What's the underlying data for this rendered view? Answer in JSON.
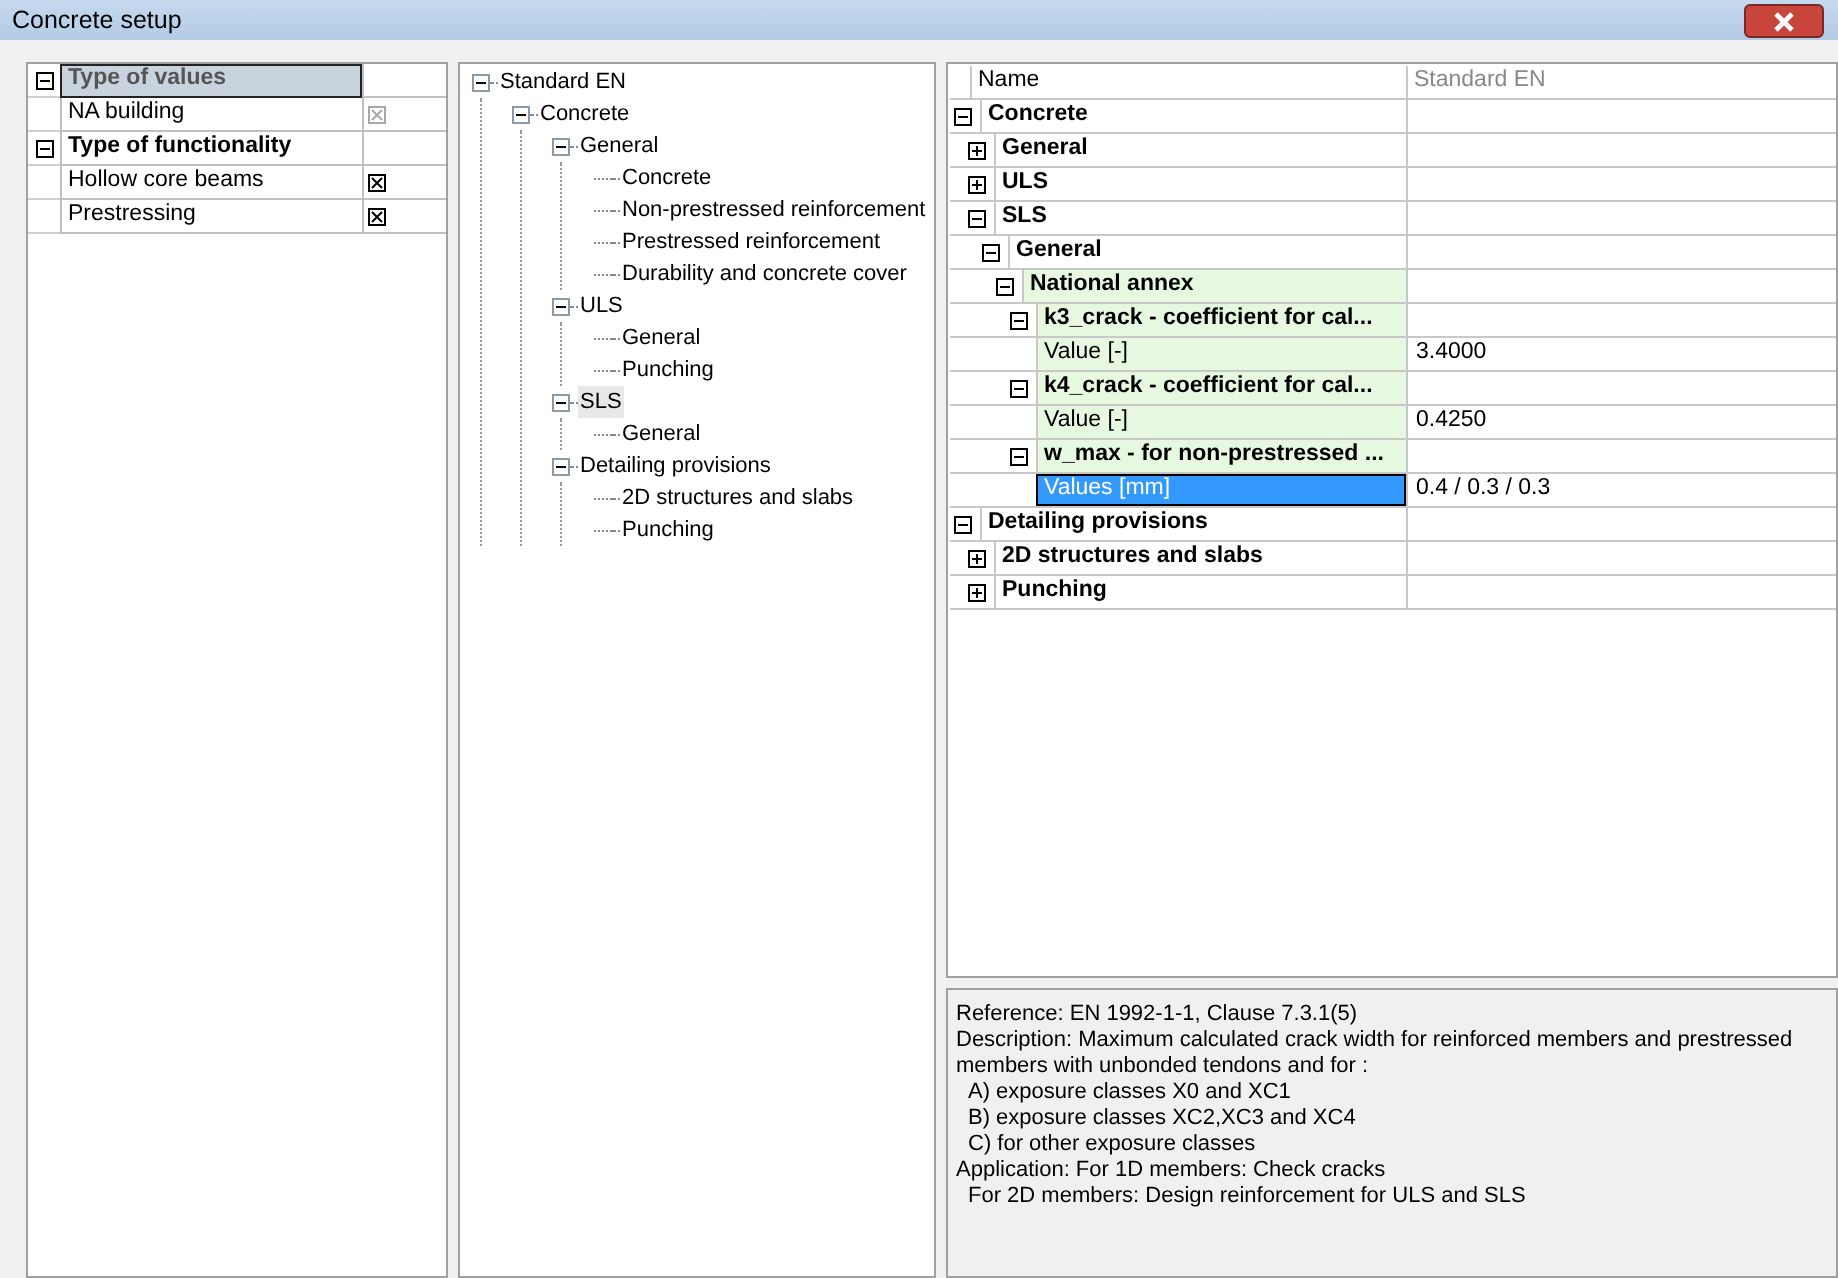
{
  "window": {
    "title": "Concrete setup"
  },
  "settings": [
    {
      "kind": "header",
      "label": "Type of values",
      "expanded": true,
      "selected": true
    },
    {
      "kind": "item",
      "label": "NA building",
      "checked": true,
      "disabled": true
    },
    {
      "kind": "header",
      "label": "Type of functionality",
      "expanded": true,
      "selected": false
    },
    {
      "kind": "item",
      "label": "Hollow core beams",
      "checked": true,
      "disabled": false
    },
    {
      "kind": "item",
      "label": "Prestressing",
      "checked": true,
      "disabled": false
    }
  ],
  "tree": [
    {
      "label": "Standard EN",
      "expanded": true,
      "selected": false,
      "children": [
        {
          "label": "Concrete",
          "expanded": true,
          "selected": false,
          "children": [
            {
              "label": "General",
              "expanded": true,
              "selected": false,
              "children": [
                {
                  "label": "Concrete",
                  "selected": false
                },
                {
                  "label": "Non-prestressed reinforcement",
                  "selected": false
                },
                {
                  "label": "Prestressed reinforcement",
                  "selected": false
                },
                {
                  "label": "Durability and concrete cover",
                  "selected": false
                }
              ]
            },
            {
              "label": "ULS",
              "expanded": true,
              "selected": false,
              "children": [
                {
                  "label": "General",
                  "selected": false
                },
                {
                  "label": "Punching",
                  "selected": false
                }
              ]
            },
            {
              "label": "SLS",
              "expanded": true,
              "selected": true,
              "children": [
                {
                  "label": "General",
                  "selected": false
                }
              ]
            },
            {
              "label": "Detailing provisions",
              "expanded": true,
              "selected": false,
              "children": [
                {
                  "label": "2D structures and slabs",
                  "selected": false
                },
                {
                  "label": "Punching",
                  "selected": false
                }
              ]
            }
          ]
        }
      ]
    }
  ],
  "properties": {
    "columns": [
      "Name",
      "Standard EN"
    ],
    "rows": [
      {
        "kind": "group",
        "name": "Concrete",
        "expanded": true,
        "shaded": false,
        "children": [
          {
            "kind": "group",
            "name": "General",
            "expanded": false,
            "shaded": false
          },
          {
            "kind": "group",
            "name": "ULS",
            "expanded": false,
            "shaded": false
          },
          {
            "kind": "group",
            "name": "SLS",
            "expanded": true,
            "shaded": false,
            "children": [
              {
                "kind": "group",
                "name": "General",
                "expanded": true,
                "shaded": false,
                "children": [
                  {
                    "kind": "group",
                    "name": "National annex",
                    "expanded": true,
                    "shaded": true,
                    "children": [
                      {
                        "kind": "group",
                        "name": "k3_crack - coefficient for cal...",
                        "expanded": true,
                        "shaded": true,
                        "children": [
                          {
                            "kind": "value",
                            "name": "Value [-]",
                            "value": "3.4000",
                            "shaded": true,
                            "selected": false
                          }
                        ]
                      },
                      {
                        "kind": "group",
                        "name": "k4_crack - coefficient for cal...",
                        "expanded": true,
                        "shaded": true,
                        "children": [
                          {
                            "kind": "value",
                            "name": "Value [-]",
                            "value": "0.4250",
                            "shaded": true,
                            "selected": false
                          }
                        ]
                      },
                      {
                        "kind": "group",
                        "name": "w_max - for non-prestressed ...",
                        "expanded": true,
                        "shaded": true,
                        "children": [
                          {
                            "kind": "value",
                            "name": "Values [mm]",
                            "value": "0.4 / 0.3 / 0.3",
                            "selected": true
                          }
                        ]
                      }
                    ]
                  }
                ]
              }
            ]
          }
        ]
      },
      {
        "kind": "group",
        "name": "Detailing provisions",
        "expanded": true,
        "shaded": false,
        "children": [
          {
            "kind": "group",
            "name": "2D structures and slabs",
            "expanded": false,
            "shaded": false
          },
          {
            "kind": "group",
            "name": "Punching",
            "expanded": false,
            "shaded": false
          }
        ]
      }
    ]
  },
  "description": [
    {
      "text": "Reference: EN 1992-1-1, Clause 7.3.1(5)",
      "indent": false
    },
    {
      "text": "Description:  Maximum calculated crack width for reinforced members and prestressed members with unbonded tendons and for :",
      "indent": false
    },
    {
      "text": "A) exposure classes X0 and XC1",
      "indent": true
    },
    {
      "text": "B) exposure classes XC2,XC3 and XC4",
      "indent": true
    },
    {
      "text": "C) for other exposure classes",
      "indent": true
    },
    {
      "text": "Application:  For 1D members: Check cracks",
      "indent": false
    },
    {
      "text": "For 2D members: Design reinforcement for ULS and SLS",
      "indent": true
    }
  ]
}
